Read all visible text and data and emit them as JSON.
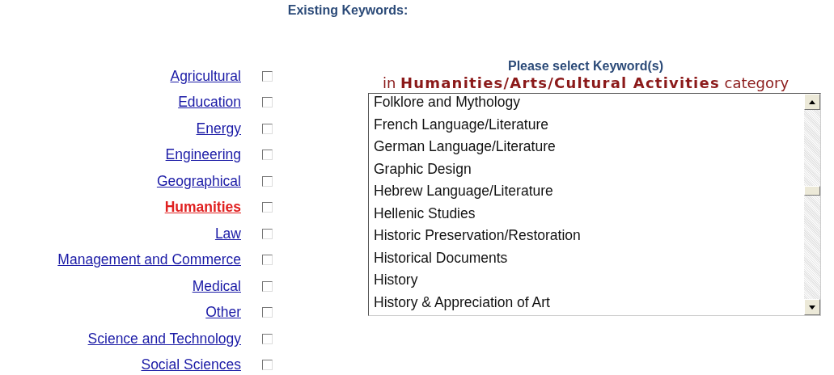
{
  "title": "Existing Keywords:",
  "categories": [
    {
      "label": "Agricultural",
      "selected": false,
      "checked": false
    },
    {
      "label": "Education",
      "selected": false,
      "checked": false
    },
    {
      "label": "Energy",
      "selected": false,
      "checked": false
    },
    {
      "label": "Engineering",
      "selected": false,
      "checked": false
    },
    {
      "label": "Geographical",
      "selected": false,
      "checked": false
    },
    {
      "label": "Humanities",
      "selected": true,
      "checked": false
    },
    {
      "label": "Law",
      "selected": false,
      "checked": false
    },
    {
      "label": "Management and Commerce",
      "selected": false,
      "checked": false
    },
    {
      "label": "Medical",
      "selected": false,
      "checked": false
    },
    {
      "label": "Other",
      "selected": false,
      "checked": false
    },
    {
      "label": "Science and Technology",
      "selected": false,
      "checked": false
    },
    {
      "label": "Social Sciences",
      "selected": false,
      "checked": false
    }
  ],
  "keyword_panel": {
    "heading": "Please select Keyword(s)",
    "subheading": "in **Humanities/Arts/Cultural Activities** category",
    "options": [
      {
        "label": "Folklore and Mythology",
        "selected": false
      },
      {
        "label": "French Language/Literature",
        "selected": false
      },
      {
        "label": "German Language/Literature",
        "selected": false
      },
      {
        "label": "Graphic Design",
        "selected": false
      },
      {
        "label": "Hebrew Language/Literature",
        "selected": false
      },
      {
        "label": "Hellenic Studies",
        "selected": false
      },
      {
        "label": "Historic Preservation/Restoration",
        "selected": false
      },
      {
        "label": "Historical Documents",
        "selected": false
      },
      {
        "label": "History",
        "selected": false
      },
      {
        "label": "History & Appreciation of Art",
        "selected": false
      }
    ]
  }
}
